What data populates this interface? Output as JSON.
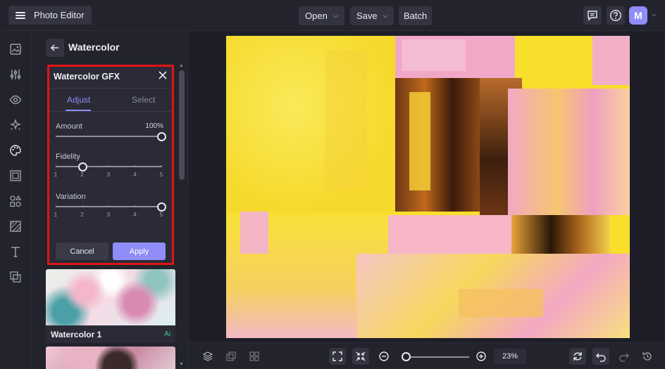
{
  "app": {
    "title": "Photo Editor"
  },
  "topbar": {
    "open_label": "Open",
    "save_label": "Save",
    "batch_label": "Batch",
    "avatar_initial": "M"
  },
  "panel": {
    "title": "Watercolor",
    "gfx": {
      "title": "Watercolor GFX",
      "tabs": [
        {
          "label": "Adjust",
          "active": true
        },
        {
          "label": "Select",
          "active": false
        }
      ],
      "amount": {
        "label": "Amount",
        "value_text": "100%",
        "value": 100
      },
      "fidelity": {
        "label": "Fidelity",
        "value": 2,
        "ticks": [
          "1",
          "2",
          "3",
          "4",
          "5"
        ]
      },
      "variation": {
        "label": "Variation",
        "value": 5,
        "ticks": [
          "1",
          "2",
          "3",
          "4",
          "5"
        ]
      },
      "cancel_label": "Cancel",
      "apply_label": "Apply"
    },
    "presets": [
      {
        "label": "Watercolor 1",
        "badge": "Ai"
      }
    ]
  },
  "bottombar": {
    "zoom_text": "23%",
    "zoom_value": 23
  },
  "colors": {
    "accent": "#8f8df7",
    "highlight_border": "#e01414",
    "ai_badge": "#4cc38a"
  }
}
